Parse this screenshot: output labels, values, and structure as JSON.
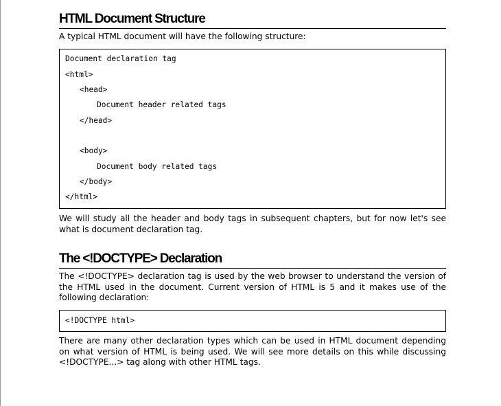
{
  "section1": {
    "title": "HTML Document Structure",
    "intro": "A typical HTML document will have the following structure:",
    "code_lines": [
      "Document declaration tag",
      "<html>",
      "<head>",
      "Document header related tags",
      "</head>",
      "<body>",
      "Document body related tags",
      "</body>",
      "</html>"
    ],
    "after": "We will study all the header and body tags in subsequent chapters, but for now let's see what is document declaration tag."
  },
  "section2": {
    "title": "The <!DOCTYPE> Declaration",
    "intro": "The <!DOCTYPE> declaration tag is used by the web browser to understand the version of the HTML used in the document. Current version of HTML is 5 and it makes use of the following declaration:",
    "code": "<!DOCTYPE html>",
    "after": "There are many other declaration types which can be used in HTML document depending on what version of HTML is being used. We will see more details on this while discussing <!DOCTYPE...> tag along with other HTML tags."
  }
}
